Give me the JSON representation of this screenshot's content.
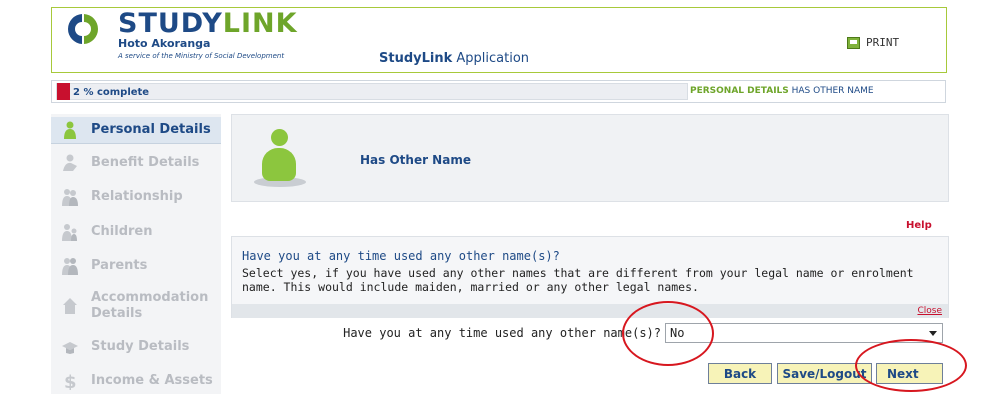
{
  "header": {
    "logo_study": "STUDY",
    "logo_link": "LINK",
    "logo_subtitle": "Hoto Akoranga",
    "logo_tagline": "A service of the Ministry of Social Development",
    "app_title_bold": "StudyLink",
    "app_title_rest": " Application",
    "print_label": "PRINT",
    "print_icon": "printer-icon"
  },
  "progress": {
    "text": "2 % complete",
    "fraction": 0.02,
    "bar_color": "#c8102e",
    "crumb_section": "PERSONAL DETAILS",
    "crumb_page": " HAS OTHER NAME"
  },
  "sidebar": {
    "items": [
      {
        "label": "Personal Details",
        "icon": "person-icon",
        "active": true
      },
      {
        "label": "Benefit Details",
        "icon": "benefit-icon",
        "active": false
      },
      {
        "label": "Relationship",
        "icon": "relationship-icon",
        "active": false
      },
      {
        "label": "Children",
        "icon": "children-icon",
        "active": false
      },
      {
        "label": "Parents",
        "icon": "parents-icon",
        "active": false
      },
      {
        "label": "Accommodation Details",
        "icon": "house-icon",
        "active": false
      },
      {
        "label": "Study Details",
        "icon": "graduation-cap-icon",
        "active": false
      },
      {
        "label": "Income & Assets",
        "icon": "dollar-icon",
        "active": false
      }
    ]
  },
  "main": {
    "section_title": "Has Other Name",
    "help_label": "Help",
    "info": {
      "question": "Have you at any time used any other name(s)?",
      "body": "Select yes, if you have used any other names that are different from your legal name or enrolment name. This would include maiden, married or any other legal names.",
      "close_label": "Close"
    },
    "question_label": "Have you at any time used any other name(s)?",
    "answer_value": "No"
  },
  "buttons": {
    "back": "Back",
    "save": "Save/Logout",
    "next": "Next"
  },
  "colors": {
    "brand_blue": "#1e4a86",
    "brand_green": "#6ea52a",
    "accent_red": "#c8102e",
    "annotation_red": "#d7171f"
  }
}
